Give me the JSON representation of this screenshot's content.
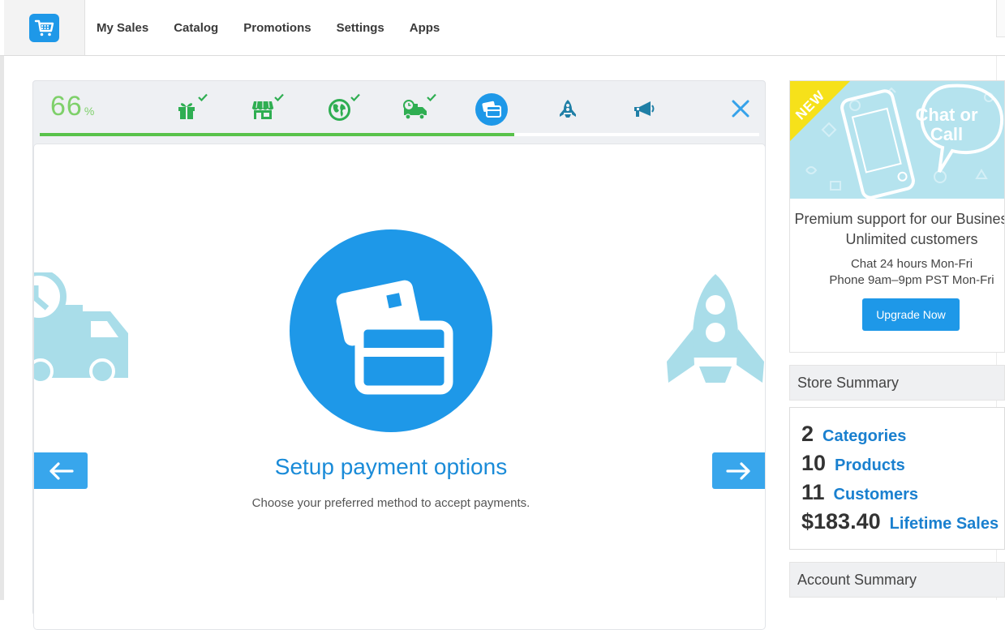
{
  "nav": {
    "items": [
      "My Sales",
      "Catalog",
      "Promotions",
      "Settings",
      "Apps"
    ]
  },
  "wizard": {
    "progress_value": "66",
    "progress_symbol": "%",
    "progress_fraction": 0.66,
    "steps": [
      {
        "icon": "gift-icon",
        "completed": true
      },
      {
        "icon": "store-icon",
        "completed": true
      },
      {
        "icon": "globe-icon",
        "completed": true
      },
      {
        "icon": "delivery-truck-icon",
        "completed": true
      },
      {
        "icon": "credit-card-icon",
        "completed": false,
        "active": true
      },
      {
        "icon": "rocket-icon",
        "completed": false
      },
      {
        "icon": "megaphone-icon",
        "completed": false
      }
    ],
    "current": {
      "title": "Setup payment options",
      "description": "Choose your preferred method to accept payments."
    }
  },
  "promo": {
    "badge": "NEW",
    "bubble": "Chat or Call",
    "headline": "Premium support for our Business & Unlimited customers",
    "hours_chat": "Chat 24 hours Mon-Fri",
    "hours_phone": "Phone 9am–9pm PST Mon-Fri",
    "button": "Upgrade Now"
  },
  "store_summary": {
    "title": "Store Summary",
    "rows": [
      {
        "value": "2",
        "label": "Categories"
      },
      {
        "value": "10",
        "label": "Products"
      },
      {
        "value": "11",
        "label": "Customers"
      },
      {
        "value": "$183.40",
        "label": "Lifetime Sales"
      }
    ]
  },
  "account_summary": {
    "title": "Account Summary"
  },
  "colors": {
    "brand_blue": "#1e98e8",
    "step_teal": "#1f7fa6",
    "complete_green": "#2fae52",
    "progress_green": "#58c24a"
  }
}
